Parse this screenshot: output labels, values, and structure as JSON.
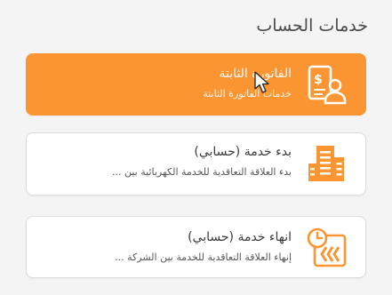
{
  "section": {
    "title": "خدمات الحساب"
  },
  "cards": [
    {
      "title": "الفاتورة الثابتة",
      "subtitle": "خدمات الفاتورة الثابتة",
      "icon": "invoice-user-icon"
    },
    {
      "title": "بدء خدمة (حسابي)",
      "subtitle": "بدء العلاقة التعاقدية للخدمة الكهربائية بين ...",
      "icon": "building-icon"
    },
    {
      "title": "انهاء خدمة (حسابي)",
      "subtitle": "إنهاء العلاقة التعاقدية للخدمة بين الشركة ...",
      "icon": "clock-arrows-icon"
    }
  ],
  "colors": {
    "accent": "#fb9532",
    "card_bg": "#ffffff",
    "page_bg": "#f4f4f4"
  }
}
